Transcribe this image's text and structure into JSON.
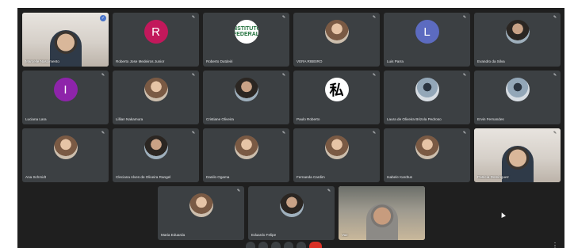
{
  "meeting": {
    "more_icon": "more-icon",
    "participants": [
      {
        "name": "Marcelle Nascimento",
        "kind": "video",
        "pinned": true
      },
      {
        "name": "Roberto Jose Medeiros Junior",
        "kind": "initial",
        "initial": "R",
        "color": "#c2185b"
      },
      {
        "name": "Roberto Dutdeiri",
        "kind": "logo",
        "logo_text": "INSTITUTO FEDERAL"
      },
      {
        "name": "VERA RIBEIRO",
        "kind": "photo"
      },
      {
        "name": "Luis Parra",
        "kind": "initial",
        "initial": "L",
        "color": "#5c6bc0"
      },
      {
        "name": "Evandro da Silva",
        "kind": "photo"
      },
      {
        "name": "Luciana Lara",
        "kind": "initial",
        "initial": "I",
        "color": "#8e24aa"
      },
      {
        "name": "Lillian Nakamura",
        "kind": "photo"
      },
      {
        "name": "Cristiane Oliveira",
        "kind": "photo"
      },
      {
        "name": "Paulo Roberto",
        "kind": "glyph",
        "glyph": "私"
      },
      {
        "name": "Laura de Oliveira Brizola Pedroso",
        "kind": "photo"
      },
      {
        "name": "Ervin Fernandes",
        "kind": "photo"
      },
      {
        "name": "Ana Schmidt",
        "kind": "photo"
      },
      {
        "name": "Cleciana Alves de Oliveira Rangel",
        "kind": "photo"
      },
      {
        "name": "Danilo Ogama",
        "kind": "photo"
      },
      {
        "name": "Fernanda Cardim",
        "kind": "photo"
      },
      {
        "name": "Isabele Kardtus",
        "kind": "photo"
      },
      {
        "name": "Patricia Dominguez",
        "kind": "video"
      },
      {
        "name": "Maria Eduarda",
        "kind": "photo"
      },
      {
        "name": "Eduardo Felipe",
        "kind": "photo"
      },
      {
        "name": "Vaz",
        "kind": "video"
      }
    ]
  }
}
